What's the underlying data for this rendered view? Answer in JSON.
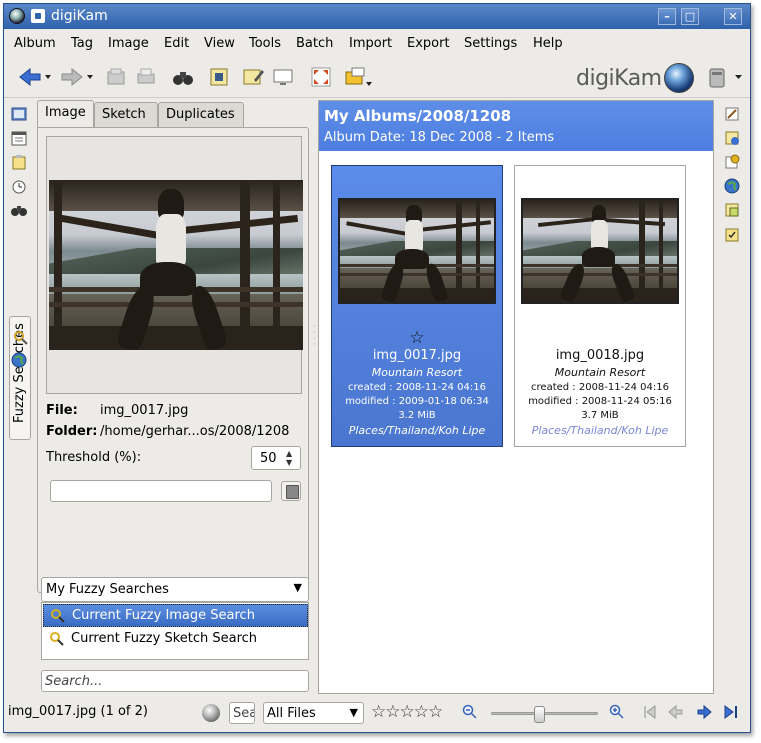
{
  "window": {
    "title": "digiKam",
    "buttons": {
      "minimize": "–",
      "maximize": "□",
      "close": "✕"
    }
  },
  "menubar": [
    "Album",
    "Tag",
    "Image",
    "Edit",
    "View",
    "Tools",
    "Batch",
    "Import",
    "Export",
    "Settings",
    "Help"
  ],
  "toolbar": {
    "logo_text": "digiKam"
  },
  "left_tabs": [
    "Image",
    "Sketch",
    "Duplicates"
  ],
  "sidebar": {
    "vertical_tab": "Fuzzy Searches"
  },
  "fuzzy": {
    "file_label": "File:",
    "file_value": "img_0017.jpg",
    "folder_label": "Folder:",
    "folder_value": "/home/gerhar...os/2008/1208",
    "threshold_label": "Threshold (%):",
    "threshold_value": "50",
    "name_value": "",
    "saved_combo": "My Fuzzy Searches",
    "saved_items": [
      "Current Fuzzy Image Search",
      "Current Fuzzy Sketch Search"
    ],
    "search_placeholder": "Search..."
  },
  "album": {
    "title": "My Albums/2008/1208",
    "subtitle": "Album Date: 18 Dec 2008 - 2 Items",
    "items": [
      {
        "name": "img_0017.jpg",
        "caption": "Mountain Resort",
        "created": "created : 2008-11-24 04:16",
        "modified": "modified : 2009-01-18 06:34",
        "size": "3.2 MiB",
        "tag": "Places/Thailand/Koh Lipe",
        "rating_star": "☆",
        "selected": true
      },
      {
        "name": "img_0018.jpg",
        "caption": "Mountain Resort",
        "created": "created : 2008-11-24 04:16",
        "modified": "modified : 2008-11-24 05:16",
        "size": "3.7 MiB",
        "tag": "Places/Thailand/Koh Lipe",
        "selected": false
      }
    ]
  },
  "statusbar": {
    "text": "img_0017.jpg (1 of 2)",
    "search_value": "Sea",
    "filter": "All Files",
    "stars": "☆☆☆☆☆",
    "zoom_level": 0.45
  },
  "colors": {
    "selection": "#4d7ee0",
    "title_bar": "#2f62ab",
    "tag_link": "#7a86d6"
  }
}
